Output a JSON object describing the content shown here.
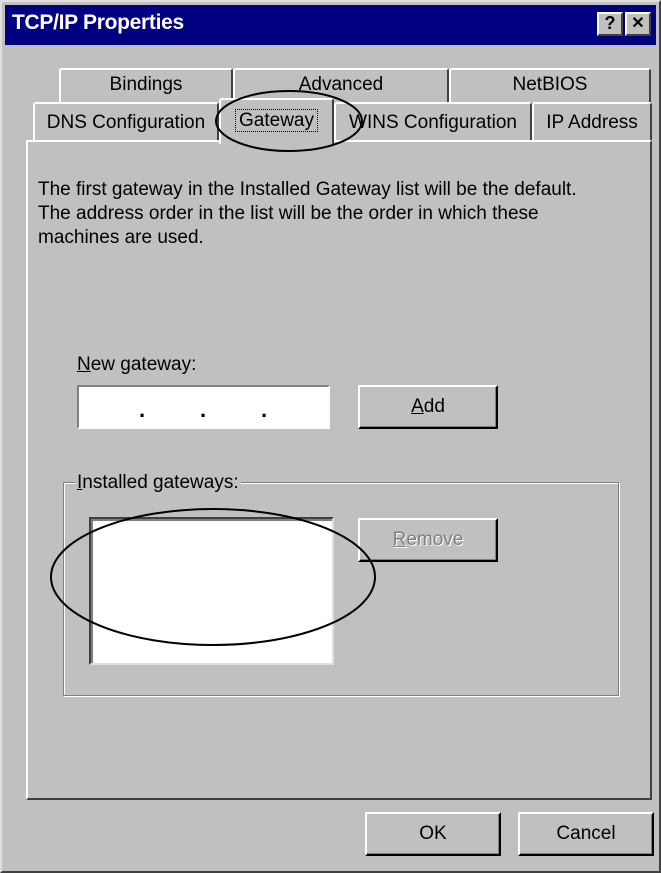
{
  "window": {
    "title": "TCP/IP Properties",
    "help_button": "?",
    "close_button": "✕"
  },
  "tabs": {
    "row1": [
      "Bindings",
      "Advanced",
      "NetBIOS"
    ],
    "row2": [
      "DNS Configuration",
      "Gateway",
      "WINS Configuration",
      "IP Address"
    ],
    "active": "Gateway"
  },
  "gateway_page": {
    "description_lines": [
      "The first gateway in the Installed Gateway list will be the default.",
      "The address order in the list will be the order in which these",
      "machines are used."
    ],
    "new_gateway_label": "New gateway:",
    "new_gateway_label_mnemonic": "N",
    "new_gateway_label_rest": "ew gateway:",
    "new_gateway_value": ". . .",
    "add_button_mnemonic": "A",
    "add_button_rest": "dd",
    "installed_gateways_mnemonic": "I",
    "installed_gateways_rest": "nstalled gateways:",
    "installed_gateways_items": [],
    "remove_button_mnemonic": "R",
    "remove_button_rest": "emove"
  },
  "footer": {
    "ok_label": "OK",
    "cancel_label": "Cancel"
  },
  "colors": {
    "titlebar": "#000080",
    "face": "#c0c0c0",
    "annotation": "#000000"
  },
  "annotations": {
    "icon": "ellipse-highlight-icon"
  }
}
